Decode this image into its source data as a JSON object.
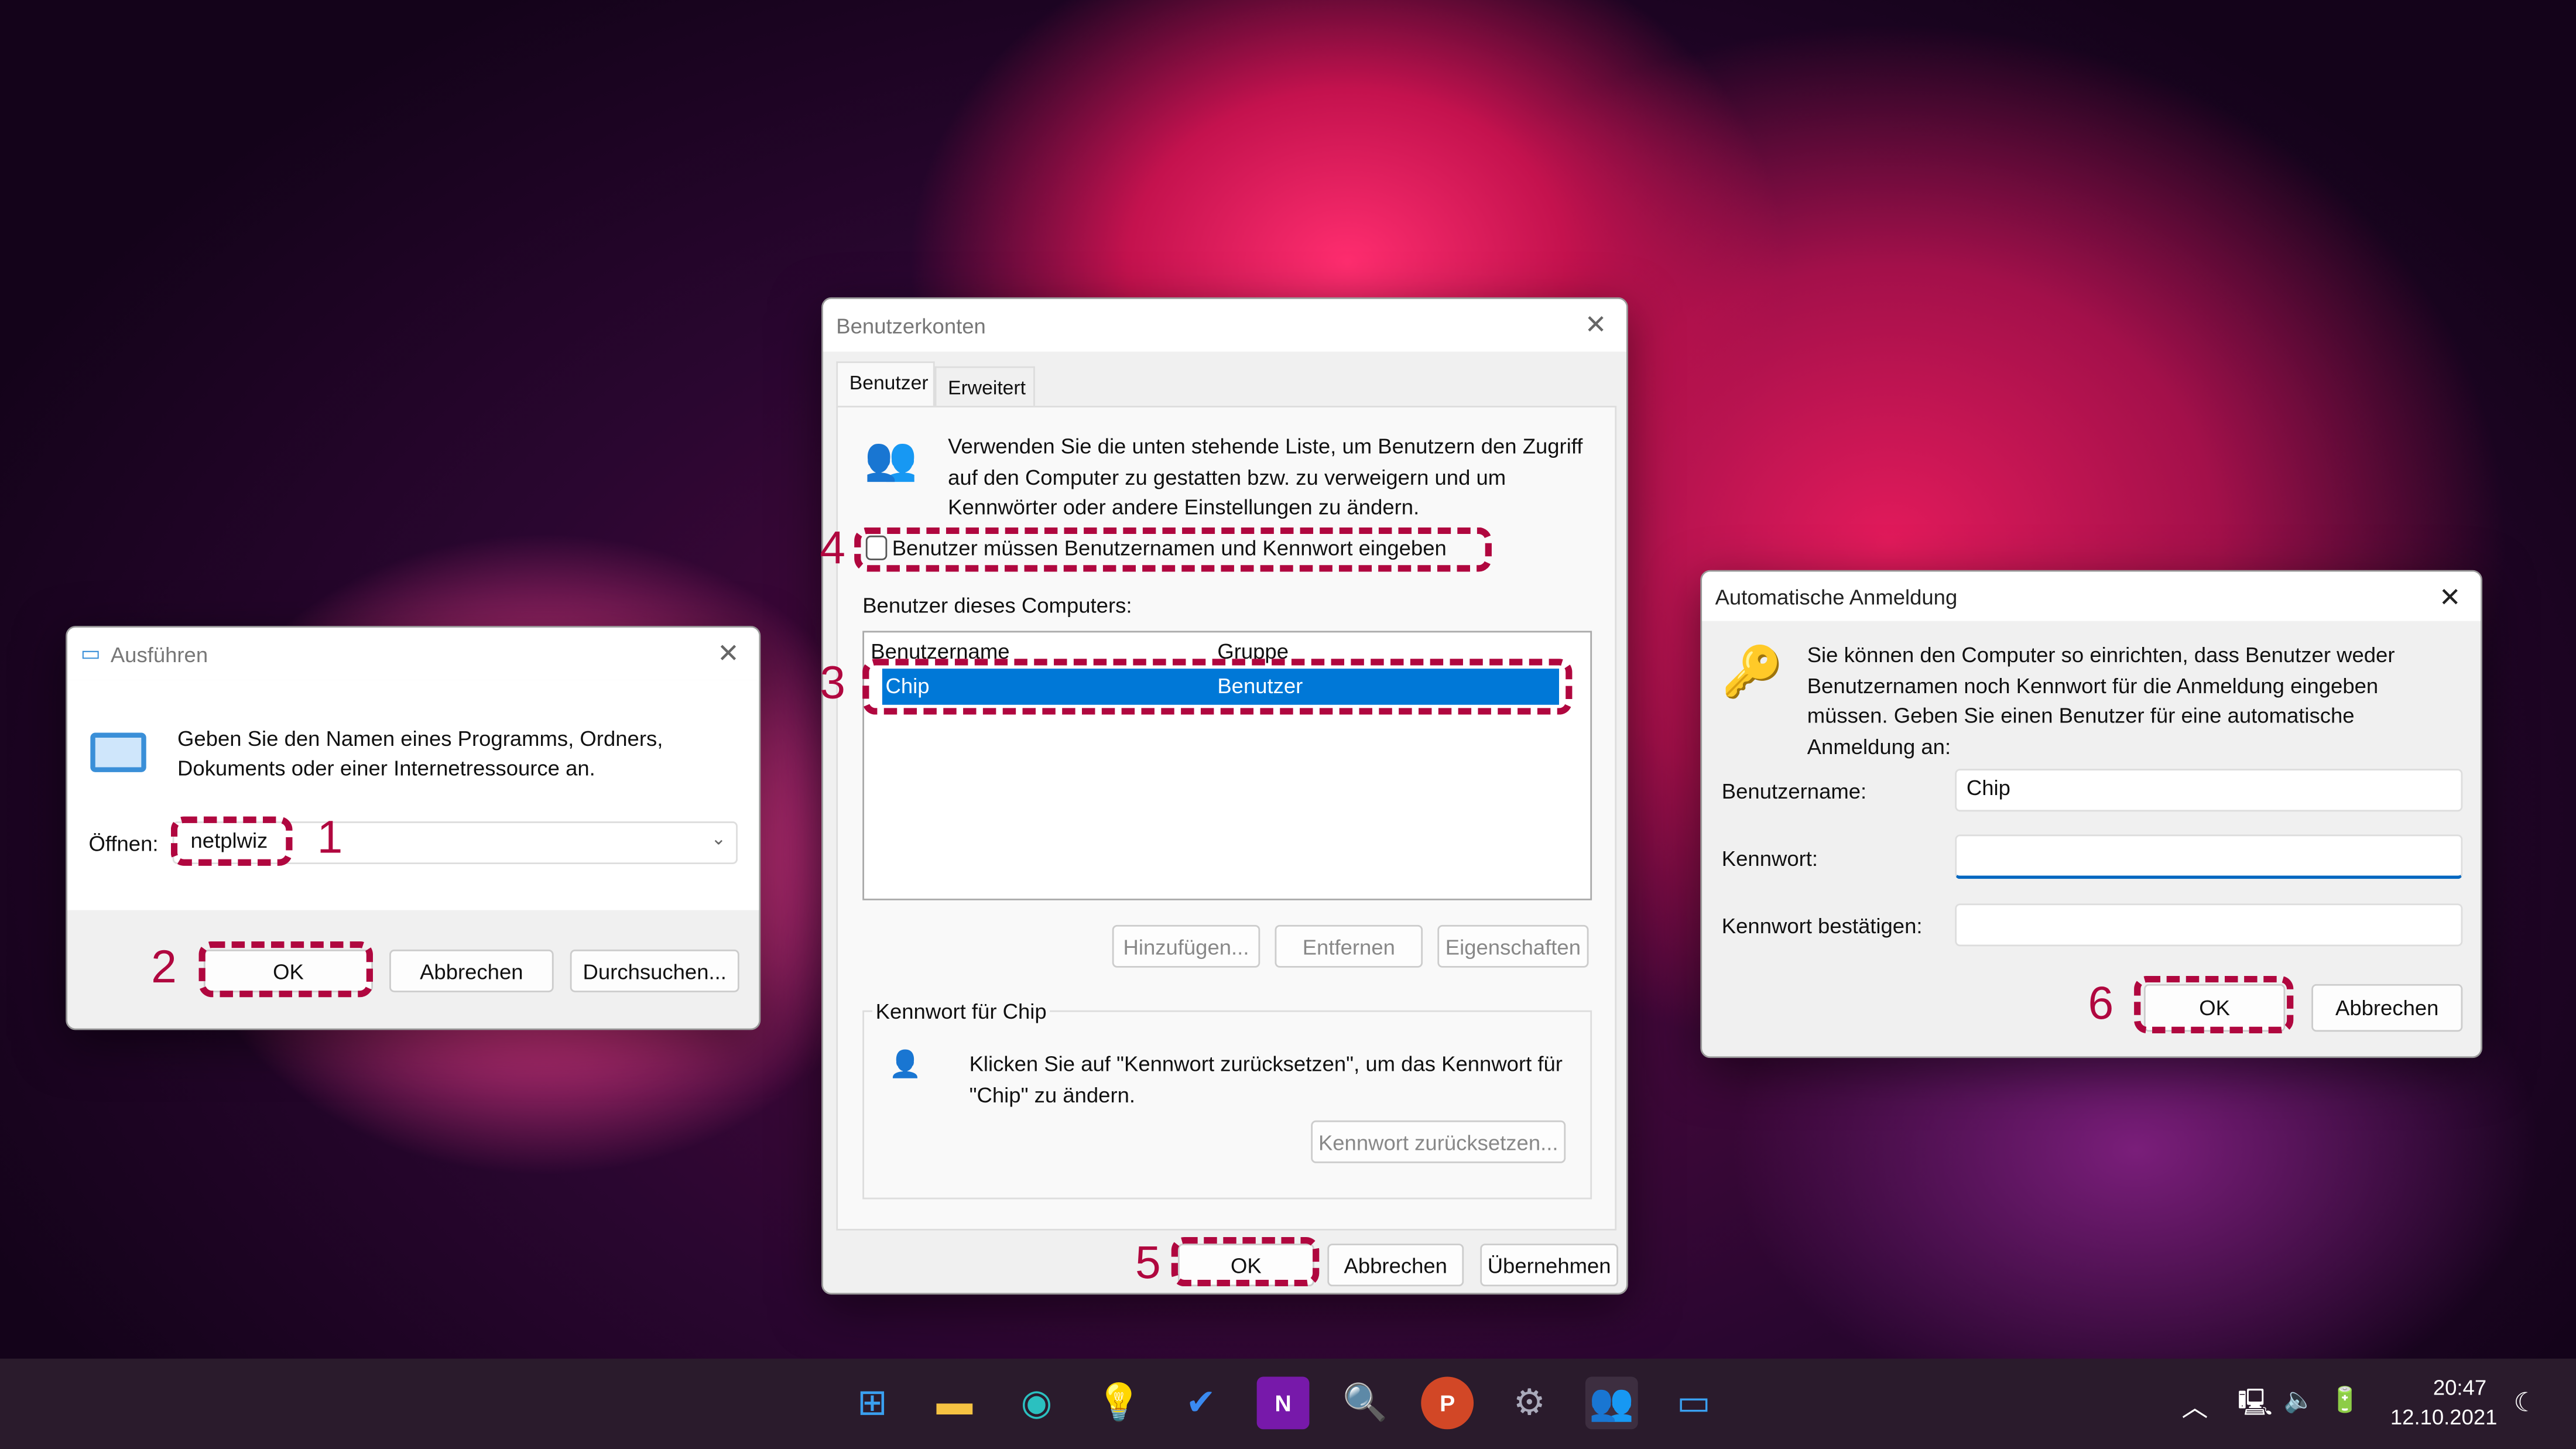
{
  "run_dialog": {
    "title": "Ausführen",
    "description": "Geben Sie den Namen eines Programms, Ordners, Dokuments oder einer Internetressource an.",
    "open_label": "Öffnen:",
    "open_value": "netplwiz",
    "ok": "OK",
    "cancel": "Abbrechen",
    "browse": "Durchsuchen..."
  },
  "accounts_dialog": {
    "title": "Benutzerkonten",
    "tabs": [
      "Benutzer",
      "Erweitert"
    ],
    "intro": "Verwenden Sie die unten stehende Liste, um Benutzern den Zugriff auf den Computer zu gestatten bzw. zu verweigern und um Kennwörter oder andere Einstellungen zu ändern.",
    "checkbox_label": "Benutzer müssen Benutzernamen und Kennwort eingeben",
    "checkbox_checked": false,
    "users_label": "Benutzer dieses Computers:",
    "columns": [
      "Benutzername",
      "Gruppe"
    ],
    "rows": [
      {
        "name": "Chip",
        "group": "Benutzer",
        "selected": true
      }
    ],
    "add": "Hinzufügen...",
    "remove": "Entfernen",
    "properties": "Eigenschaften",
    "password_group": "Kennwort für Chip",
    "password_text": "Klicken Sie auf \"Kennwort zurücksetzen\", um das Kennwort für \"Chip\" zu ändern.",
    "reset": "Kennwort zurücksetzen...",
    "ok": "OK",
    "cancel": "Abbrechen",
    "apply": "Übernehmen"
  },
  "autologin_dialog": {
    "title": "Automatische Anmeldung",
    "text": "Sie können den Computer so einrichten, dass Benutzer weder Benutzernamen noch Kennwort für die Anmeldung eingeben müssen. Geben Sie einen Benutzer für eine automatische Anmeldung an:",
    "username_label": "Benutzername:",
    "username_value": "Chip",
    "password_label": "Kennwort:",
    "password_value": "",
    "confirm_label": "Kennwort bestätigen:",
    "confirm_value": "",
    "ok": "OK",
    "cancel": "Abbrechen"
  },
  "steps": [
    "1",
    "2",
    "3",
    "4",
    "5",
    "6"
  ],
  "taskbar": {
    "apps": [
      "windows-start",
      "file-explorer",
      "edge",
      "tips",
      "todo",
      "onenote",
      "search",
      "powerpoint",
      "settings",
      "user-accounts",
      "run"
    ],
    "time": "20:47",
    "date": "12.10.2021"
  },
  "colors": {
    "annotation": "#b0073f",
    "selection": "#0078d7",
    "taskbar": "#2a1b2c"
  }
}
